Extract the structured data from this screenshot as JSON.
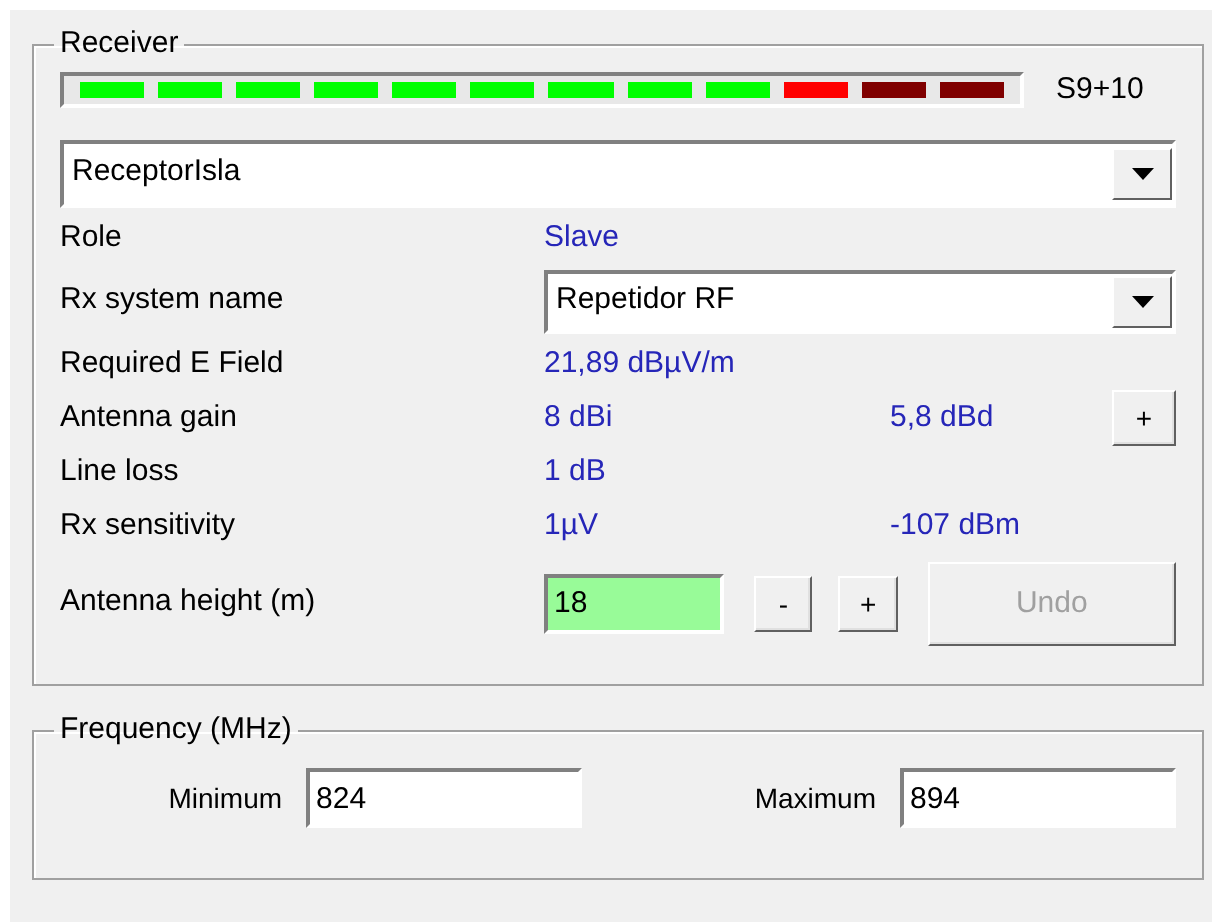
{
  "receiver": {
    "title": "Receiver",
    "signal_meter": {
      "segments": [
        {
          "color": "#00ff00"
        },
        {
          "color": "#00ff00"
        },
        {
          "color": "#00ff00"
        },
        {
          "color": "#00ff00"
        },
        {
          "color": "#00ff00"
        },
        {
          "color": "#00ff00"
        },
        {
          "color": "#00ff00"
        },
        {
          "color": "#00ff00"
        },
        {
          "color": "#00ff00"
        },
        {
          "color": "#ff0000"
        },
        {
          "color": "#800000"
        },
        {
          "color": "#800000"
        }
      ],
      "reading": "S9+10"
    },
    "station": {
      "value": "ReceptorIsla"
    },
    "rows": [
      {
        "kind": "text",
        "label": "Role",
        "value": "Slave"
      },
      {
        "kind": "combo",
        "label": "Rx system name",
        "value": "Repetidor RF"
      },
      {
        "kind": "text",
        "label": "Required E Field",
        "value": "21,89 dBµV/m"
      },
      {
        "kind": "text",
        "label": "Antenna gain",
        "value": "8 dBi",
        "value_2": "5,8 dBd",
        "button": "+"
      },
      {
        "kind": "text",
        "label": "Line loss",
        "value": "1 dB"
      },
      {
        "kind": "text",
        "label": "Rx sensitivity",
        "value": "1µV",
        "value_2": "-107 dBm"
      },
      {
        "kind": "input",
        "label": "Antenna height (m)",
        "value": "18",
        "highlighted": true,
        "buttons": [
          {
            "label": "-",
            "disabled": false
          },
          {
            "label": "+",
            "disabled": false
          },
          {
            "label": "Undo",
            "disabled": true
          }
        ]
      }
    ]
  },
  "frequency": {
    "title": "Frequency (MHz)",
    "fields": [
      {
        "label": "Minimum",
        "value": "824"
      },
      {
        "label": "Maximum",
        "value": "894"
      }
    ]
  }
}
